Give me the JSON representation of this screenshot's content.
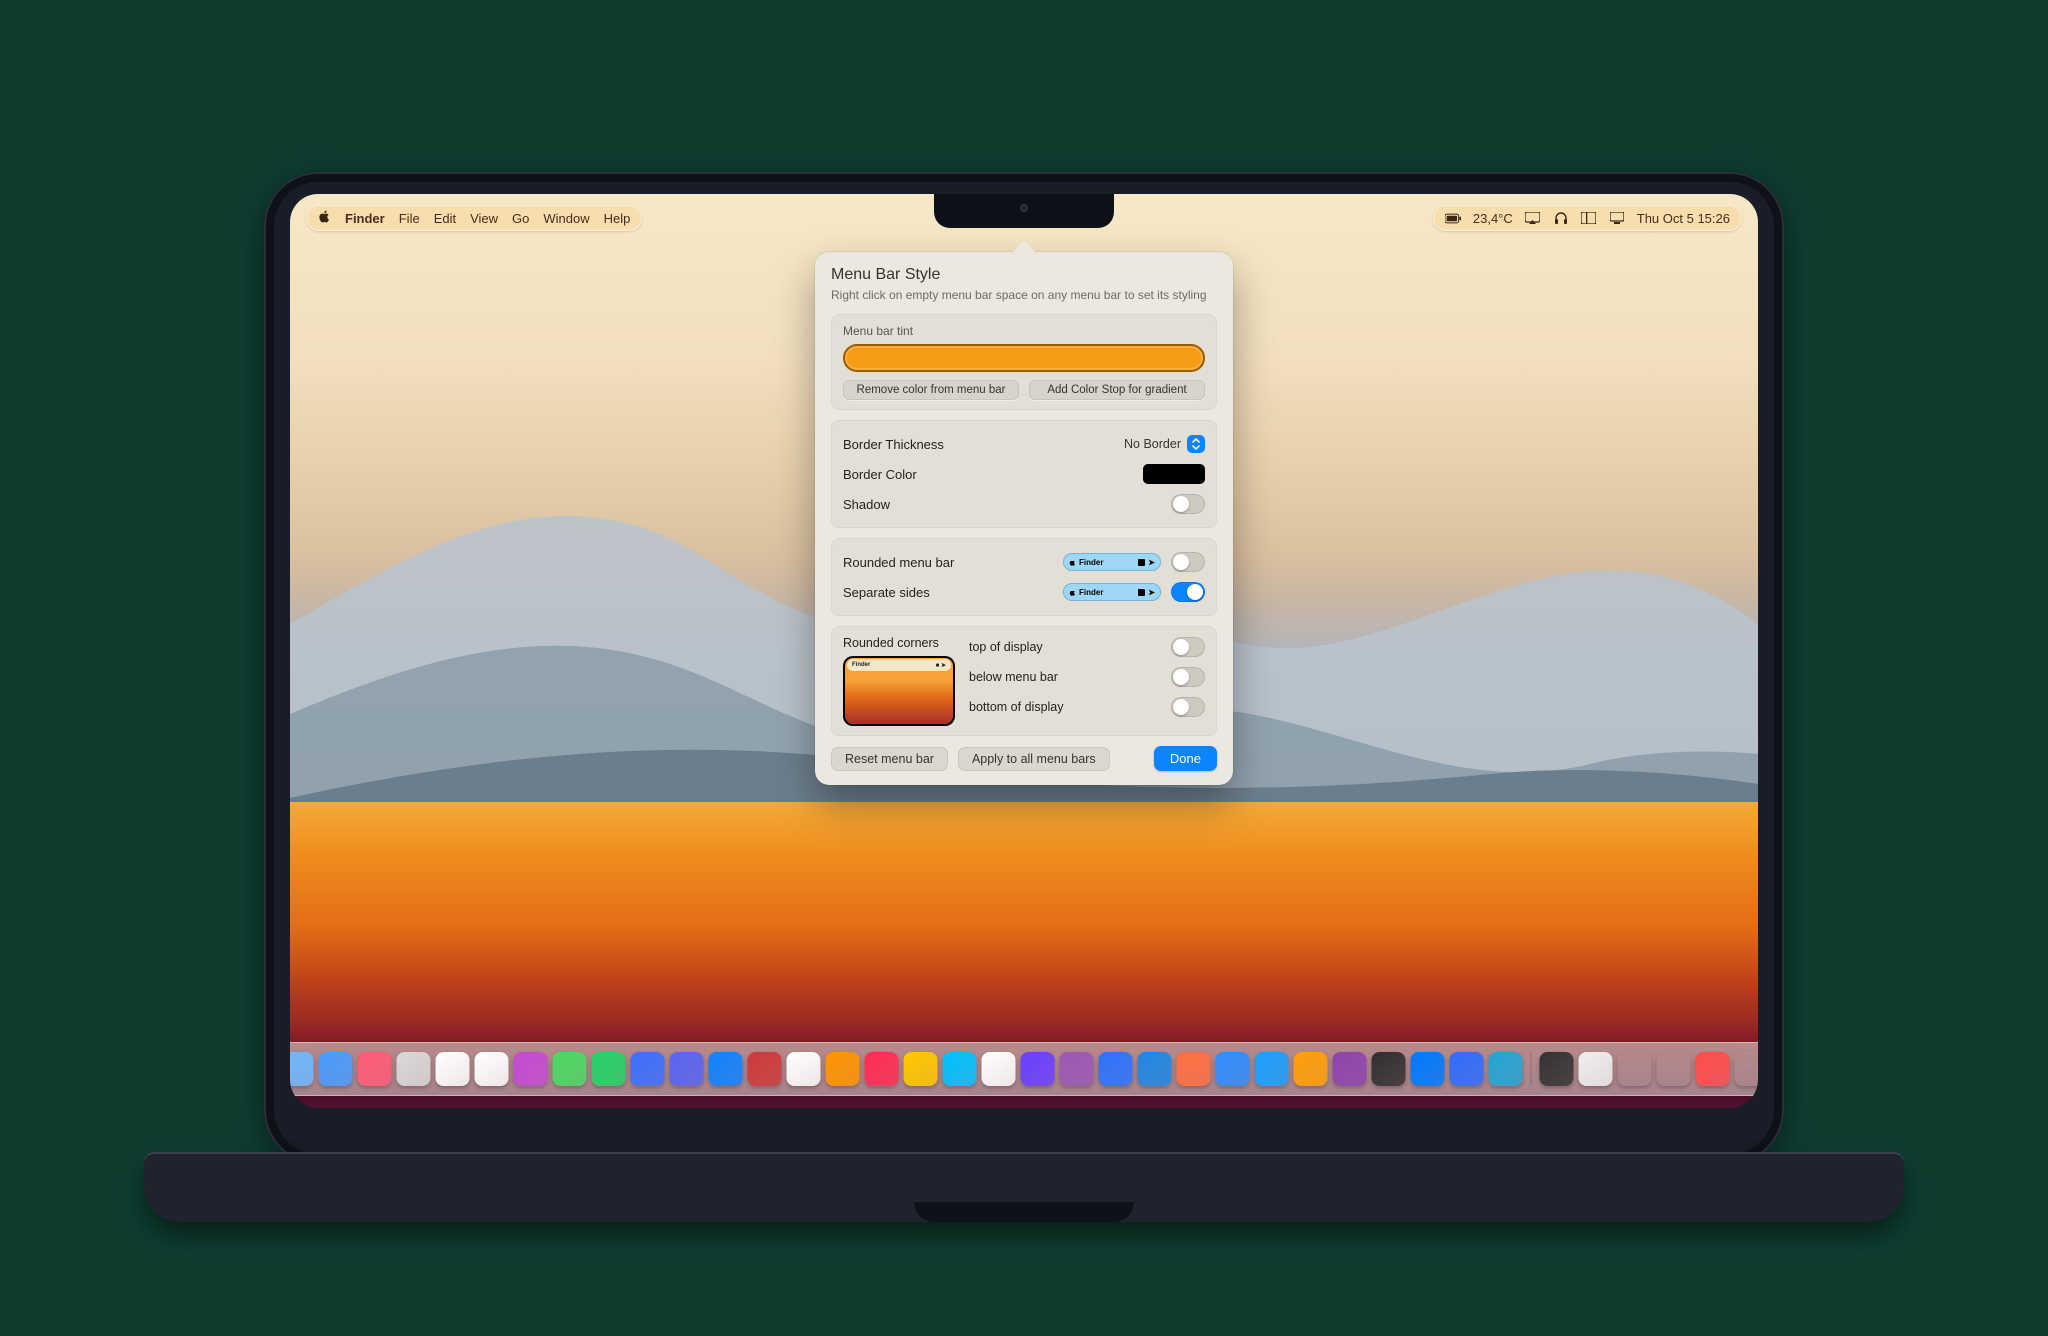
{
  "menubar": {
    "app": "Finder",
    "items": [
      "File",
      "Edit",
      "View",
      "Go",
      "Window",
      "Help"
    ],
    "right": {
      "temp": "23,4°C",
      "datetime": "Thu Oct 5  15:26"
    }
  },
  "popover": {
    "title": "Menu Bar Style",
    "subtitle": "Right click on empty menu bar space on any menu bar to set its styling",
    "tint": {
      "label": "Menu bar tint",
      "color": "#f59b14",
      "remove_label": "Remove color from menu bar",
      "add_stop_label": "Add Color Stop for gradient"
    },
    "border": {
      "thickness_label": "Border Thickness",
      "thickness_value": "No Border",
      "color_label": "Border Color",
      "color_value": "#000000",
      "shadow_label": "Shadow",
      "shadow_on": false
    },
    "rounded": {
      "rounded_label": "Rounded menu bar",
      "rounded_on": false,
      "separate_label": "Separate sides",
      "separate_on": true,
      "mini_app": "Finder"
    },
    "corners": {
      "label": "Rounded corners",
      "top_label": "top of display",
      "top_on": false,
      "below_label": "below menu bar",
      "below_on": false,
      "bottom_label": "bottom of display",
      "bottom_on": false
    },
    "footer": {
      "reset_label": "Reset menu bar",
      "apply_label": "Apply to all menu bars",
      "done_label": "Done"
    }
  },
  "dock_colors": [
    "#6fb8ff",
    "#4a9cff",
    "#ff5b77",
    "#d9d9d9",
    "#ffffff",
    "#ffffff",
    "#c54bd4",
    "#4cd964",
    "#25d366",
    "#3c6fff",
    "#5865f2",
    "#0f83ff",
    "#ce3a3a",
    "#ffffff",
    "#ff9500",
    "#ff2d55",
    "#ffc800",
    "#00c2ff",
    "#ffffff",
    "#6a3fff",
    "#9b59b6",
    "#2b74ff",
    "#1e88e5",
    "#ff7043",
    "#2f8eff",
    "#1aa0ff",
    "#ff9f0a",
    "#8e44ad",
    "#303030",
    "#007aff",
    "#2e6dff",
    "#23a6d5",
    "#333333",
    "#efefef",
    "#111",
    "#111",
    "#ff4d4d",
    "#888"
  ]
}
